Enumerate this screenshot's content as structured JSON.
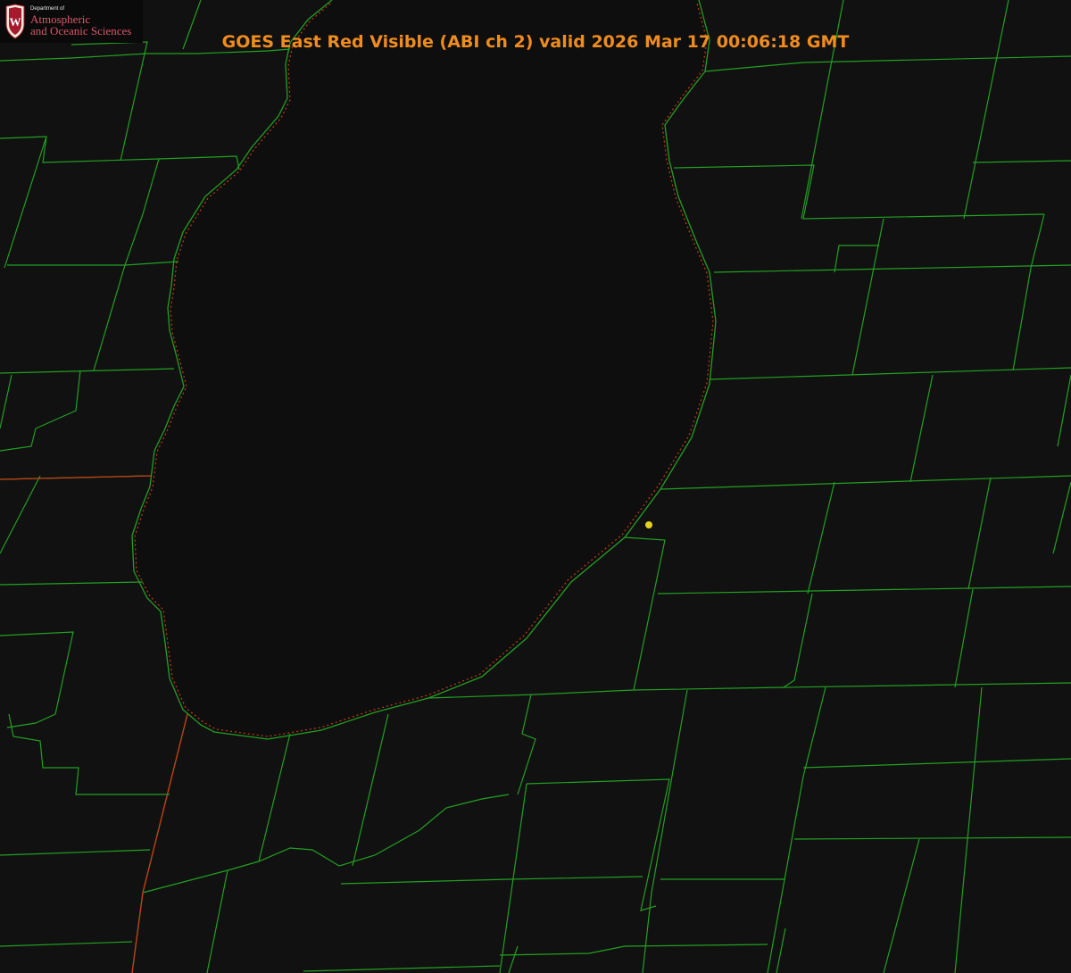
{
  "title": "GOES East Red Visible (ABI ch 2) valid 2026 Mar 17 00:06:18 GMT",
  "logo": {
    "small_text": "Department of",
    "line1": "Atmospheric",
    "line2": "and Oceanic Sciences",
    "letter": "W"
  },
  "colors": {
    "background": "#111111",
    "lake": "#0e0e0e",
    "boundary_lines": "#22a022",
    "state_line": "#c83c14",
    "title": "#f08c1e",
    "logo_text": "#d9586a",
    "logo_shield": "#a51a2e",
    "marker": "#e6d21e"
  },
  "icons": {
    "logo": "uw-crest-icon",
    "marker": "location-dot-icon"
  }
}
